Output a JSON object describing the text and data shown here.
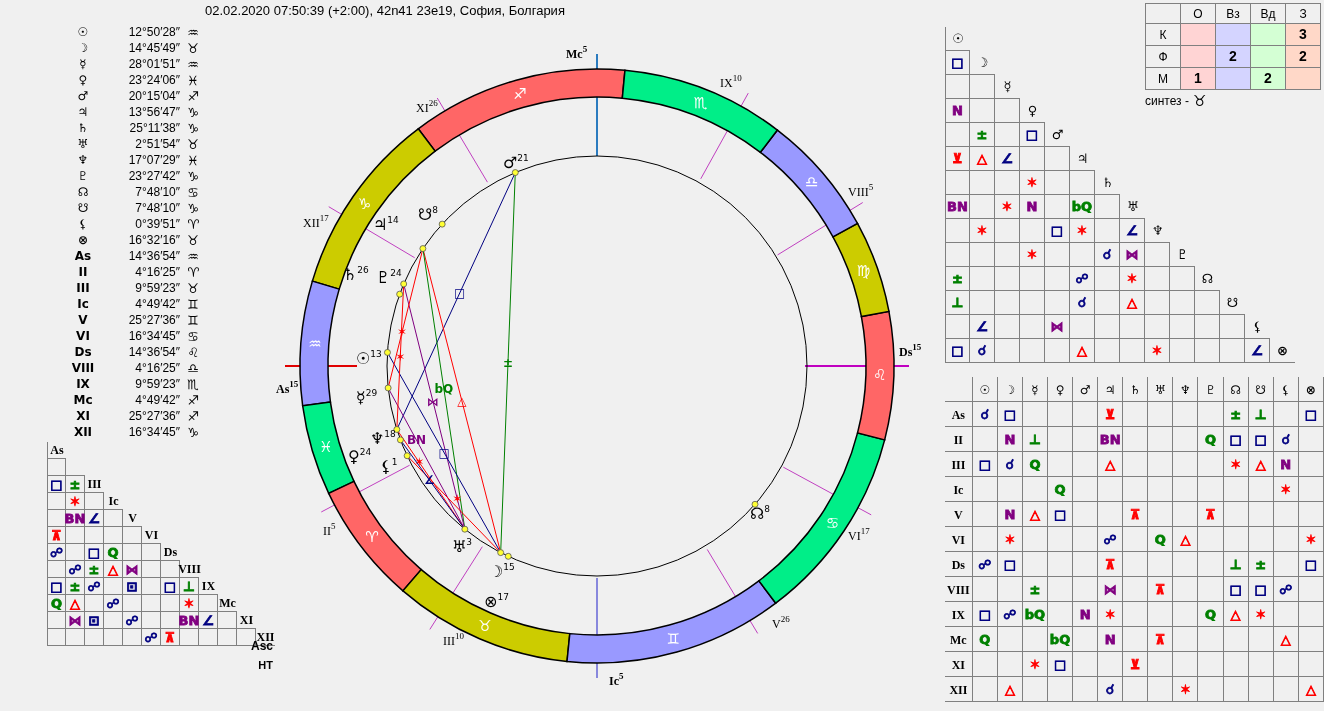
{
  "title": "02.02.2020 07:50:39 (+2:00), 42n41 23e19, София, Болгария",
  "positions": [
    {
      "symbol": "☉",
      "degree": "12°50′28″",
      "sign": "♒"
    },
    {
      "symbol": "☽",
      "degree": "14°45′49″",
      "sign": "♉"
    },
    {
      "symbol": "☿",
      "degree": "28°01′51″",
      "sign": "♒"
    },
    {
      "symbol": "♀",
      "degree": "23°24′06″",
      "sign": "♓"
    },
    {
      "symbol": "♂",
      "degree": "20°15′04″",
      "sign": "♐"
    },
    {
      "symbol": "♃",
      "degree": "13°56′47″",
      "sign": "♑"
    },
    {
      "symbol": "♄",
      "degree": "25°11′38″",
      "sign": "♑"
    },
    {
      "symbol": "♅",
      "degree": "2°51′54″",
      "sign": "♉"
    },
    {
      "symbol": "♆",
      "degree": "17°07′29″",
      "sign": "♓"
    },
    {
      "symbol": "♇",
      "degree": "23°27′42″",
      "sign": "♑"
    },
    {
      "symbol": "☊",
      "degree": "7°48′10″",
      "sign": "♋"
    },
    {
      "symbol": "☋",
      "degree": "7°48′10″",
      "sign": "♑"
    },
    {
      "symbol": "⚸",
      "degree": "0°39′51″",
      "sign": "♈"
    },
    {
      "symbol": "⊗",
      "degree": "16°32′16″",
      "sign": "♉"
    },
    {
      "symbol": "As",
      "degree": "14°36′54″",
      "sign": "♒"
    },
    {
      "symbol": "II",
      "degree": "4°16′25″",
      "sign": "♈"
    },
    {
      "symbol": "III",
      "degree": "9°59′23″",
      "sign": "♉"
    },
    {
      "symbol": "Ic",
      "degree": "4°49′42″",
      "sign": "♊"
    },
    {
      "symbol": "V",
      "degree": "25°27′36″",
      "sign": "♊"
    },
    {
      "symbol": "VI",
      "degree": "16°34′45″",
      "sign": "♋"
    },
    {
      "symbol": "Ds",
      "degree": "14°36′54″",
      "sign": "♌"
    },
    {
      "symbol": "VIII",
      "degree": "4°16′25″",
      "sign": "♎"
    },
    {
      "symbol": "IX",
      "degree": "9°59′23″",
      "sign": "♏"
    },
    {
      "symbol": "Mc",
      "degree": "4°49′42″",
      "sign": "♐"
    },
    {
      "symbol": "XI",
      "degree": "25°27′36″",
      "sign": "♐"
    },
    {
      "symbol": "XII",
      "degree": "16°34′45″",
      "sign": "♑"
    }
  ],
  "house_grid": {
    "rows": [
      {
        "label": "As",
        "cells": []
      },
      {
        "cells": [
          null
        ]
      },
      {
        "label": "III",
        "cells": [
          {
            "g": "□",
            "color": "#000080"
          },
          {
            "g": "±",
            "color": "#008000"
          }
        ]
      },
      {
        "label": "Ic",
        "cells": [
          null,
          {
            "g": "✶",
            "color": "#ff0000"
          },
          null
        ]
      },
      {
        "label": "V",
        "cells": [
          null,
          {
            "g": "BN",
            "color": "#800080"
          },
          {
            "g": "∠",
            "color": "#000080"
          },
          null
        ]
      },
      {
        "label": "VI",
        "cells": [
          {
            "g": "⊼",
            "color": "#ff0000"
          },
          null,
          null,
          null,
          null
        ]
      },
      {
        "label": "Ds",
        "cells": [
          {
            "g": "☍",
            "color": "#000080"
          },
          null,
          {
            "g": "□",
            "color": "#000080"
          },
          {
            "g": "Q",
            "color": "#008000"
          },
          null,
          null
        ]
      },
      {
        "label": "VIII",
        "cells": [
          null,
          {
            "g": "☍",
            "color": "#000080"
          },
          {
            "g": "±",
            "color": "#008000"
          },
          {
            "g": "△",
            "color": "#ff0000"
          },
          {
            "g": "⋈",
            "color": "#800080"
          },
          null,
          null
        ]
      },
      {
        "label": "IX",
        "cells": [
          {
            "g": "□",
            "color": "#000080"
          },
          {
            "g": "±",
            "color": "#008000"
          },
          {
            "g": "☍",
            "color": "#000080"
          },
          null,
          {
            "g": "⊡",
            "color": "#000080"
          },
          null,
          {
            "g": "□",
            "color": "#000080"
          },
          {
            "g": "⊥",
            "color": "#008000"
          }
        ]
      },
      {
        "label": "Mc",
        "cells": [
          {
            "g": "Q",
            "color": "#008000"
          },
          {
            "g": "△",
            "color": "#ff0000"
          },
          null,
          {
            "g": "☍",
            "color": "#000080"
          },
          null,
          null,
          null,
          {
            "g": "✶",
            "color": "#ff0000"
          },
          null
        ]
      },
      {
        "label": "XI",
        "cells": [
          null,
          {
            "g": "⋈",
            "color": "#800080"
          },
          {
            "g": "⊡",
            "color": "#000080"
          },
          null,
          {
            "g": "☍",
            "color": "#000080"
          },
          null,
          null,
          {
            "g": "BN",
            "color": "#800080"
          },
          {
            "g": "∠",
            "color": "#000080"
          },
          null
        ]
      },
      {
        "label": "XII",
        "cells": [
          null,
          null,
          null,
          null,
          null,
          {
            "g": "☍",
            "color": "#000080"
          },
          {
            "g": "⊼",
            "color": "#ff0000"
          },
          null,
          null,
          null,
          null
        ]
      }
    ],
    "end_label": "Asc",
    "footer": "НТ"
  },
  "wheel": {
    "signs": [
      {
        "glyph": "♐",
        "color": "#ff6666"
      },
      {
        "glyph": "♑",
        "color": "#cccc00"
      },
      {
        "glyph": "♒",
        "color": "#9999ff"
      },
      {
        "glyph": "♓",
        "color": "#00ee88"
      },
      {
        "glyph": "♈",
        "color": "#ff6666"
      },
      {
        "glyph": "♉",
        "color": "#cccc00"
      },
      {
        "glyph": "♊",
        "color": "#9999ff"
      },
      {
        "glyph": "♋",
        "color": "#00ee88"
      },
      {
        "glyph": "♌",
        "color": "#ff6666"
      },
      {
        "glyph": "♍",
        "color": "#cccc00"
      },
      {
        "glyph": "♎",
        "color": "#9999ff"
      },
      {
        "glyph": "♏",
        "color": "#00ee88"
      }
    ],
    "houses": [
      {
        "label": "Mc",
        "sup": "5"
      },
      {
        "label": "XI",
        "sup": "26"
      },
      {
        "label": "XII",
        "sup": "17"
      },
      {
        "label": "As",
        "sup": "15"
      },
      {
        "label": "II",
        "sup": "5"
      },
      {
        "label": "III",
        "sup": "10"
      },
      {
        "label": "Ic",
        "sup": "5"
      },
      {
        "label": "V",
        "sup": "26"
      },
      {
        "label": "VI",
        "sup": "17"
      },
      {
        "label": "Ds",
        "sup": "15"
      },
      {
        "label": "VIII",
        "sup": "5"
      },
      {
        "label": "IX",
        "sup": "10"
      }
    ],
    "planets": [
      {
        "glyph": "♂",
        "sup": "21"
      },
      {
        "glyph": "☋",
        "sup": "8"
      },
      {
        "glyph": "♃",
        "sup": "14"
      },
      {
        "glyph": "♄",
        "sup": "26"
      },
      {
        "glyph": "♇",
        "sup": "24"
      },
      {
        "glyph": "☉",
        "sup": "13"
      },
      {
        "glyph": "☿",
        "sup": "29"
      },
      {
        "glyph": "♆",
        "sup": "18"
      },
      {
        "glyph": "♀",
        "sup": "24"
      },
      {
        "glyph": "⚸",
        "sup": "1"
      },
      {
        "glyph": "♅",
        "sup": "3"
      },
      {
        "glyph": "☽",
        "sup": "15"
      },
      {
        "glyph": "⊗",
        "sup": "17"
      },
      {
        "glyph": "☊",
        "sup": "8"
      }
    ],
    "aspect_marks": [
      {
        "mark": "±",
        "color": "#008000"
      },
      {
        "mark": "□",
        "color": "#000080"
      },
      {
        "mark": "△",
        "color": "#ff0000"
      },
      {
        "mark": "bQ",
        "color": "#008000"
      },
      {
        "mark": "⋈",
        "color": "#800080"
      },
      {
        "mark": "□",
        "color": "#000080"
      },
      {
        "mark": "BN",
        "color": "#800080"
      },
      {
        "mark": "✶",
        "color": "#ff0000"
      },
      {
        "mark": "✶",
        "color": "#ff0000"
      },
      {
        "mark": "✶",
        "color": "#ff0000"
      },
      {
        "mark": "✶",
        "color": "#ff0000"
      },
      {
        "mark": "∠",
        "color": "#000080"
      }
    ]
  },
  "element_table": {
    "columns": [
      "О",
      "Вз",
      "Вд",
      "З"
    ],
    "rows": [
      {
        "label": "К",
        "values": [
          {
            "color": "#ffd4d4"
          },
          {
            "color": "#d4d4ff"
          },
          {
            "color": "#d4ffd4"
          },
          {
            "value": "3",
            "color": "#ffd8c8"
          }
        ]
      },
      {
        "label": "Ф",
        "values": [
          {
            "color": "#ffd4d4"
          },
          {
            "value": "2",
            "color": "#d4d4ff"
          },
          {
            "color": "#d4ffd4"
          },
          {
            "value": "2",
            "color": "#ffd8c8"
          }
        ]
      },
      {
        "label": "М",
        "values": [
          {
            "value": "1",
            "color": "#ffd4d4"
          },
          {
            "color": "#d4d4ff"
          },
          {
            "value": "2",
            "color": "#d4ffd4"
          },
          {
            "color": "#ffd8c8"
          }
        ]
      }
    ],
    "synthesis_label": "синтез -",
    "synthesis_sign": "♉"
  },
  "planet_grid": {
    "rows": [
      {
        "label": "☉",
        "cells": []
      },
      {
        "label": "☽",
        "cells": [
          {
            "g": "□",
            "color": "#000080"
          }
        ]
      },
      {
        "label": "☿",
        "cells": [
          null,
          null
        ]
      },
      {
        "label": "♀",
        "cells": [
          {
            "g": "N",
            "color": "#800080"
          },
          null,
          null
        ]
      },
      {
        "label": "♂",
        "cells": [
          null,
          {
            "g": "±",
            "color": "#008000"
          },
          null,
          {
            "g": "□",
            "color": "#000080"
          }
        ]
      },
      {
        "label": "♃",
        "cells": [
          {
            "g": "⊻",
            "color": "#ff0000"
          },
          {
            "g": "△",
            "color": "#ff0000"
          },
          {
            "g": "∠",
            "color": "#000080"
          },
          null,
          null
        ]
      },
      {
        "label": "♄",
        "cells": [
          null,
          null,
          null,
          {
            "g": "✶",
            "color": "#ff0000"
          },
          null,
          null
        ]
      },
      {
        "label": "♅",
        "cells": [
          {
            "g": "BN",
            "color": "#800080"
          },
          null,
          {
            "g": "✶",
            "color": "#ff0000"
          },
          {
            "g": "N",
            "color": "#800080"
          },
          null,
          {
            "g": "bQ",
            "color": "#008000"
          },
          null
        ]
      },
      {
        "label": "♆",
        "cells": [
          null,
          {
            "g": "✶",
            "color": "#ff0000"
          },
          null,
          null,
          {
            "g": "□",
            "color": "#000080"
          },
          {
            "g": "✶",
            "color": "#ff0000"
          },
          null,
          {
            "g": "∠",
            "color": "#000080"
          }
        ]
      },
      {
        "label": "♇",
        "cells": [
          null,
          null,
          null,
          {
            "g": "✶",
            "color": "#ff0000"
          },
          null,
          null,
          {
            "g": "☌",
            "color": "#000080"
          },
          {
            "g": "⋈",
            "color": "#800080"
          },
          null
        ]
      },
      {
        "label": "☊",
        "cells": [
          {
            "g": "±",
            "color": "#008000"
          },
          null,
          null,
          null,
          null,
          {
            "g": "☍",
            "color": "#000080"
          },
          null,
          {
            "g": "✶",
            "color": "#ff0000"
          },
          null,
          null
        ]
      },
      {
        "label": "☋",
        "cells": [
          {
            "g": "⊥",
            "color": "#008000"
          },
          null,
          null,
          null,
          null,
          {
            "g": "☌",
            "color": "#000080"
          },
          null,
          {
            "g": "△",
            "color": "#ff0000"
          },
          null,
          null,
          null
        ]
      },
      {
        "label": "⚸",
        "cells": [
          null,
          {
            "g": "∠",
            "color": "#000080"
          },
          null,
          null,
          {
            "g": "⋈",
            "color": "#800080"
          },
          null,
          null,
          null,
          null,
          null,
          null,
          null
        ]
      },
      {
        "label": "⊗",
        "cells": [
          {
            "g": "□",
            "color": "#000080"
          },
          {
            "g": "☌",
            "color": "#000080"
          },
          null,
          null,
          null,
          {
            "g": "△",
            "color": "#ff0000"
          },
          null,
          null,
          {
            "g": "✶",
            "color": "#ff0000"
          },
          null,
          null,
          null,
          {
            "g": "∠",
            "color": "#000080"
          }
        ]
      }
    ]
  },
  "house_planet_table": {
    "columns": [
      "☉",
      "☽",
      "☿",
      "♀",
      "♂",
      "♃",
      "♄",
      "♅",
      "♆",
      "♇",
      "☊",
      "☋",
      "⚸",
      "⊗"
    ],
    "rows": [
      {
        "label": "As",
        "cells": [
          {
            "g": "☌",
            "color": "#000080"
          },
          {
            "g": "□",
            "color": "#000080"
          },
          null,
          null,
          null,
          {
            "g": "⊻",
            "color": "#ff0000"
          },
          null,
          null,
          null,
          null,
          {
            "g": "±",
            "color": "#008000"
          },
          {
            "g": "⊥",
            "color": "#008000"
          },
          null,
          {
            "g": "□",
            "color": "#000080"
          }
        ]
      },
      {
        "label": "II",
        "cells": [
          null,
          {
            "g": "N",
            "color": "#800080"
          },
          {
            "g": "⊥",
            "color": "#008000"
          },
          null,
          null,
          {
            "g": "BN",
            "color": "#800080"
          },
          null,
          null,
          null,
          {
            "g": "Q",
            "color": "#008000"
          },
          {
            "g": "□",
            "color": "#000080"
          },
          {
            "g": "□",
            "color": "#000080"
          },
          {
            "g": "☌",
            "color": "#000080"
          },
          null
        ]
      },
      {
        "label": "III",
        "cells": [
          {
            "g": "□",
            "color": "#000080"
          },
          {
            "g": "☌",
            "color": "#000080"
          },
          {
            "g": "Q",
            "color": "#008000"
          },
          null,
          null,
          {
            "g": "△",
            "color": "#ff0000"
          },
          null,
          null,
          null,
          null,
          {
            "g": "✶",
            "color": "#ff0000"
          },
          {
            "g": "△",
            "color": "#ff0000"
          },
          {
            "g": "N",
            "color": "#800080"
          },
          null
        ]
      },
      {
        "label": "Ic",
        "cells": [
          null,
          null,
          null,
          {
            "g": "Q",
            "color": "#008000"
          },
          null,
          null,
          null,
          null,
          null,
          null,
          null,
          null,
          {
            "g": "✶",
            "color": "#ff0000"
          },
          null
        ]
      },
      {
        "label": "V",
        "cells": [
          null,
          {
            "g": "N",
            "color": "#800080"
          },
          {
            "g": "△",
            "color": "#ff0000"
          },
          {
            "g": "□",
            "color": "#000080"
          },
          null,
          null,
          {
            "g": "⊼",
            "color": "#ff0000"
          },
          null,
          null,
          {
            "g": "⊼",
            "color": "#ff0000"
          },
          null,
          null,
          null,
          null
        ]
      },
      {
        "label": "VI",
        "cells": [
          null,
          {
            "g": "✶",
            "color": "#ff0000"
          },
          null,
          null,
          null,
          {
            "g": "☍",
            "color": "#000080"
          },
          null,
          {
            "g": "Q",
            "color": "#008000"
          },
          {
            "g": "△",
            "color": "#ff0000"
          },
          null,
          null,
          null,
          null,
          {
            "g": "✶",
            "color": "#ff0000"
          }
        ]
      },
      {
        "label": "Ds",
        "cells": [
          {
            "g": "☍",
            "color": "#000080"
          },
          {
            "g": "□",
            "color": "#000080"
          },
          null,
          null,
          null,
          {
            "g": "⊼",
            "color": "#ff0000"
          },
          null,
          null,
          null,
          null,
          {
            "g": "⊥",
            "color": "#008000"
          },
          {
            "g": "±",
            "color": "#008000"
          },
          null,
          {
            "g": "□",
            "color": "#000080"
          }
        ]
      },
      {
        "label": "VIII",
        "cells": [
          null,
          null,
          {
            "g": "±",
            "color": "#008000"
          },
          null,
          null,
          {
            "g": "⋈",
            "color": "#800080"
          },
          null,
          {
            "g": "⊼",
            "color": "#ff0000"
          },
          null,
          null,
          {
            "g": "□",
            "color": "#000080"
          },
          {
            "g": "□",
            "color": "#000080"
          },
          {
            "g": "☍",
            "color": "#000080"
          },
          null
        ]
      },
      {
        "label": "IX",
        "cells": [
          {
            "g": "□",
            "color": "#000080"
          },
          {
            "g": "☍",
            "color": "#000080"
          },
          {
            "g": "bQ",
            "color": "#008000"
          },
          null,
          {
            "g": "N",
            "color": "#800080"
          },
          {
            "g": "✶",
            "color": "#ff0000"
          },
          null,
          null,
          null,
          {
            "g": "Q",
            "color": "#008000"
          },
          {
            "g": "△",
            "color": "#ff0000"
          },
          {
            "g": "✶",
            "color": "#ff0000"
          },
          null,
          null
        ]
      },
      {
        "label": "Mc",
        "cells": [
          {
            "g": "Q",
            "color": "#008000"
          },
          null,
          null,
          {
            "g": "bQ",
            "color": "#008000"
          },
          null,
          {
            "g": "N",
            "color": "#800080"
          },
          null,
          {
            "g": "⊼",
            "color": "#ff0000"
          },
          null,
          null,
          null,
          null,
          {
            "g": "△",
            "color": "#ff0000"
          },
          null
        ]
      },
      {
        "label": "XI",
        "cells": [
          null,
          null,
          {
            "g": "✶",
            "color": "#ff0000"
          },
          {
            "g": "□",
            "color": "#000080"
          },
          null,
          null,
          {
            "g": "⊻",
            "color": "#ff0000"
          },
          null,
          null,
          null,
          null,
          null,
          null,
          null
        ]
      },
      {
        "label": "XII",
        "cells": [
          null,
          {
            "g": "△",
            "color": "#ff0000"
          },
          null,
          null,
          null,
          {
            "g": "☌",
            "color": "#000080"
          },
          null,
          null,
          {
            "g": "✶",
            "color": "#ff0000"
          },
          null,
          null,
          null,
          null,
          {
            "g": "△",
            "color": "#ff0000"
          }
        ]
      }
    ]
  }
}
